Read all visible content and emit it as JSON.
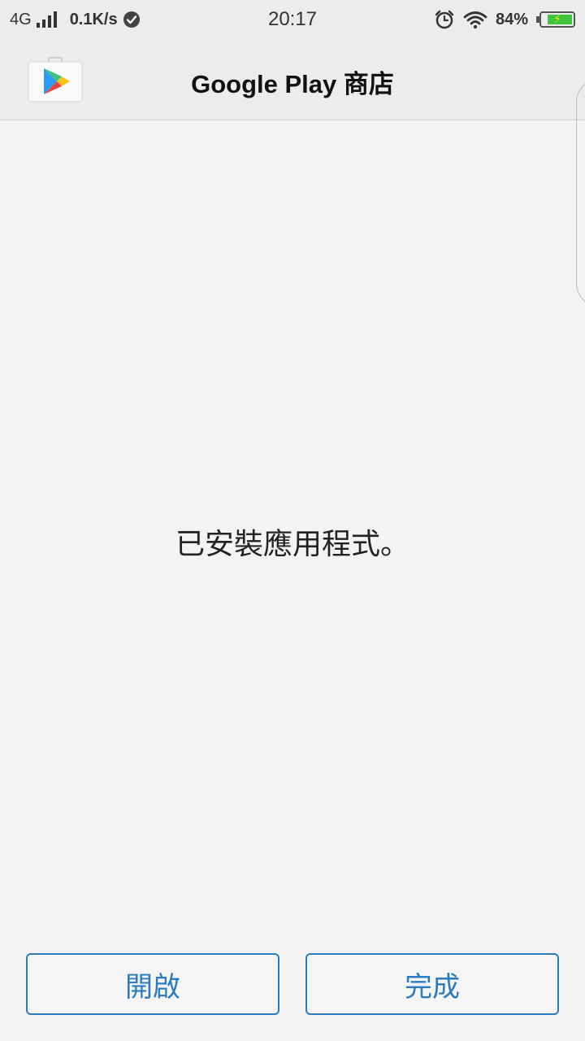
{
  "status_bar": {
    "network": "4G",
    "speed": "0.1K/s",
    "time": "20:17",
    "battery_percent_label": "84%",
    "battery_level": 0.84,
    "icons": [
      "signal-icon",
      "check-circle-icon",
      "alarm-icon",
      "wifi-icon",
      "battery-charging-icon"
    ]
  },
  "header": {
    "title": "Google Play 商店",
    "icon": "google-play-store-icon"
  },
  "main": {
    "message": "已安裝應用程式。"
  },
  "buttons": {
    "open_label": "開啟",
    "done_label": "完成"
  },
  "colors": {
    "accent": "#2b7bc3",
    "background": "#f3f3f3",
    "header_bg": "#ececec",
    "battery_fill": "#3fc43f"
  }
}
